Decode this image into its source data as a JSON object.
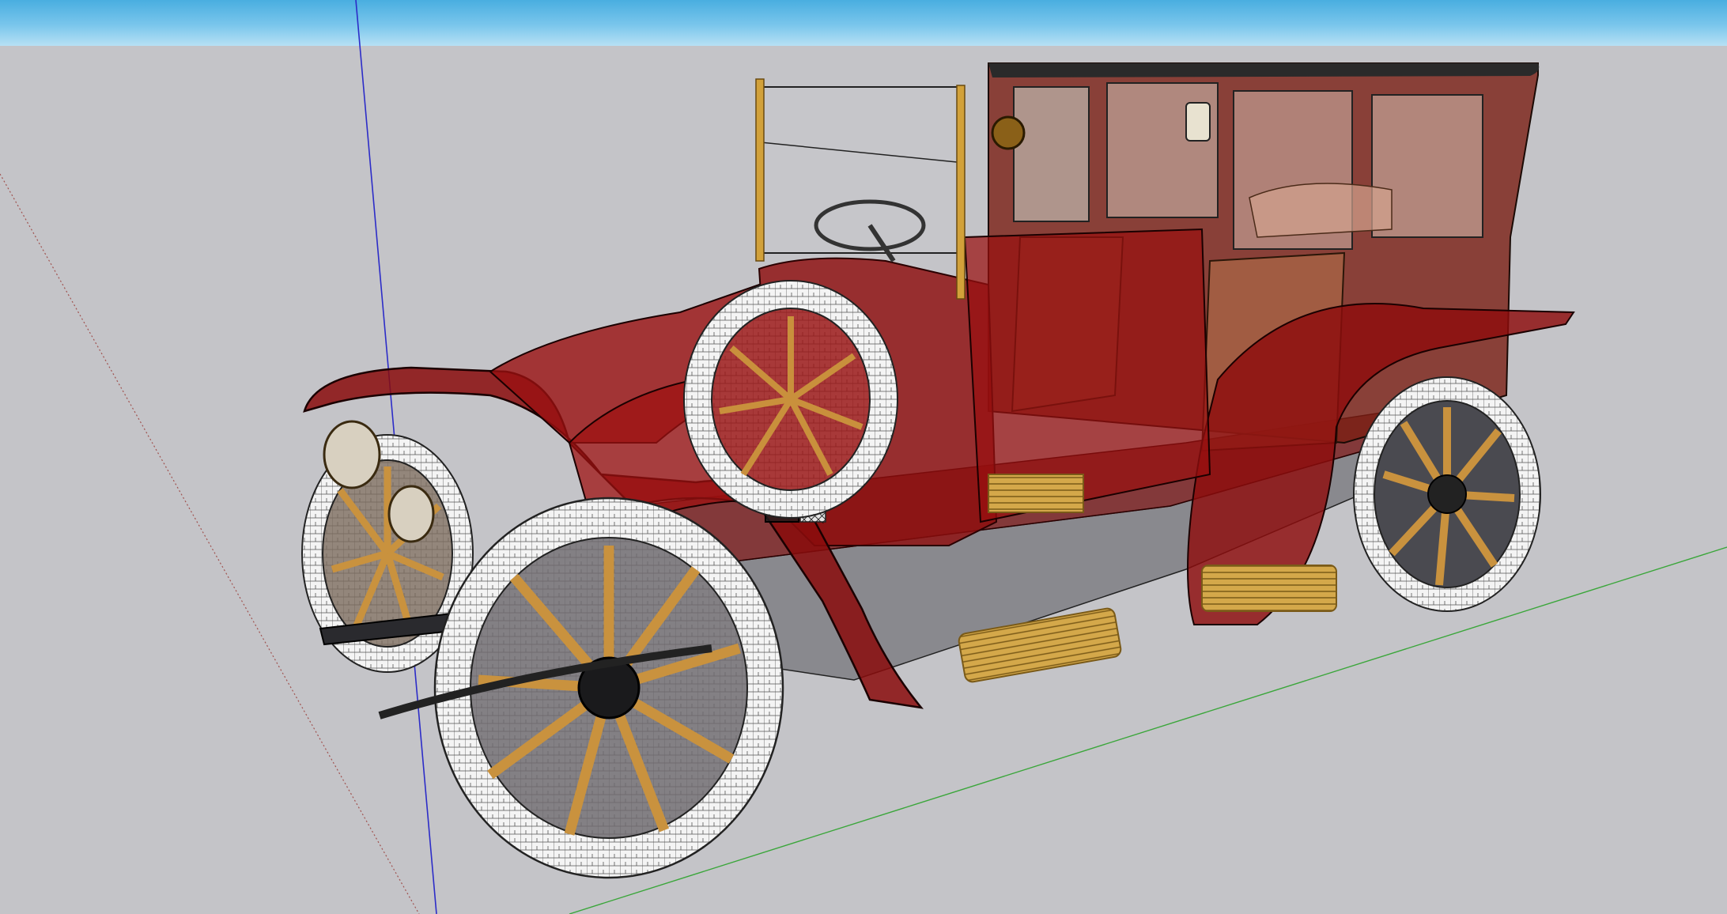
{
  "app": {
    "kind": "3d-modeling-viewport",
    "view_style": "x-ray"
  },
  "scene": {
    "model_name": "vintage-car-model",
    "colors": {
      "sky_top": "#49aee0",
      "sky_bottom": "#b7e0f4",
      "ground": "#c4c4c8",
      "body_red": "#8b0d0d",
      "brass": "#c99a2c",
      "tire": "#f2f2f2",
      "spoke": "#b8863a",
      "axis_red": "#a0524f",
      "axis_green": "#3aa63a",
      "axis_blue": "#2c2cc8"
    }
  }
}
